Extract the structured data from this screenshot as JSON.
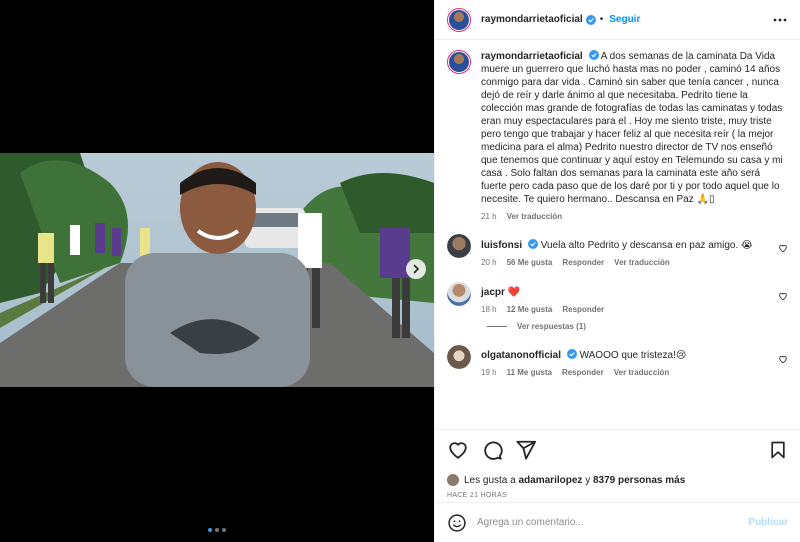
{
  "post": {
    "author": "raymondarrietaoficial",
    "follow_label": "Seguir",
    "caption": "A dos semanas de la caminata Da Vida muere un guerrero que luchó hasta mas no poder , caminó 14 años conmigo para dar vida . Caminó sin saber que tenía cancer , nunca dejó de reír y darle ánimo al que necesitaba. Pedrito tiene la colección mas grande de fotografías de todas las caminatas y todas eran muy espectaculares para el . Hoy me siento triste, muy triste pero tengo que trabajar y hacer feliz al que necesita reír ( la mejor medicina para el alma) Pedrito nuestro director de TV nos enseñó que tenemos que continuar y aquí estoy en Telemundo su casa y mi casa . Solo faltan dos semanas para la caminata este año será fuerte pero cada paso que de los daré por ti y por todo aquel que lo necesite. Te quiero hermano.. Descansa en Paz 🙏▯",
    "caption_time": "21 h",
    "see_translation": "Ver traducción"
  },
  "comments": [
    {
      "user": "luisfonsi",
      "verified": true,
      "text": "Vuela alto Pedrito y descansa en paz amigo. 😭",
      "time": "20 h",
      "likes": "56 Me gusta",
      "reply": "Responder",
      "translate": "Ver traducción"
    },
    {
      "user": "jacpr",
      "verified": false,
      "text": "❤️",
      "time": "18 h",
      "likes": "12 Me gusta",
      "reply": "Responder",
      "replies_label": "Ver respuestas (1)"
    },
    {
      "user": "olgatanonofficial",
      "verified": true,
      "text": "WAOOO que tristeza!😢",
      "time": "19 h",
      "likes": "11 Me gusta",
      "reply": "Responder",
      "translate": "Ver traducción"
    }
  ],
  "likes_summary": {
    "prefix": "Les gusta a",
    "user": "adamarilopez",
    "middle": "y",
    "count": "8379 personas más"
  },
  "post_time": "HACE 21 HORAS",
  "comment_input": {
    "placeholder": "Agrega un comentario..."
  },
  "publish_label": "Publicar",
  "carousel": {
    "slides": 3,
    "active": 1
  },
  "colors": {
    "link": "#0095f6",
    "verified": "#3897f0",
    "heart": "#ed4956",
    "publish_disabled": "#b2dffc"
  },
  "icons": [
    "like-icon",
    "comment-icon",
    "share-icon",
    "bookmark-icon",
    "emoji-icon",
    "more-icon",
    "next-icon",
    "verified-icon"
  ]
}
